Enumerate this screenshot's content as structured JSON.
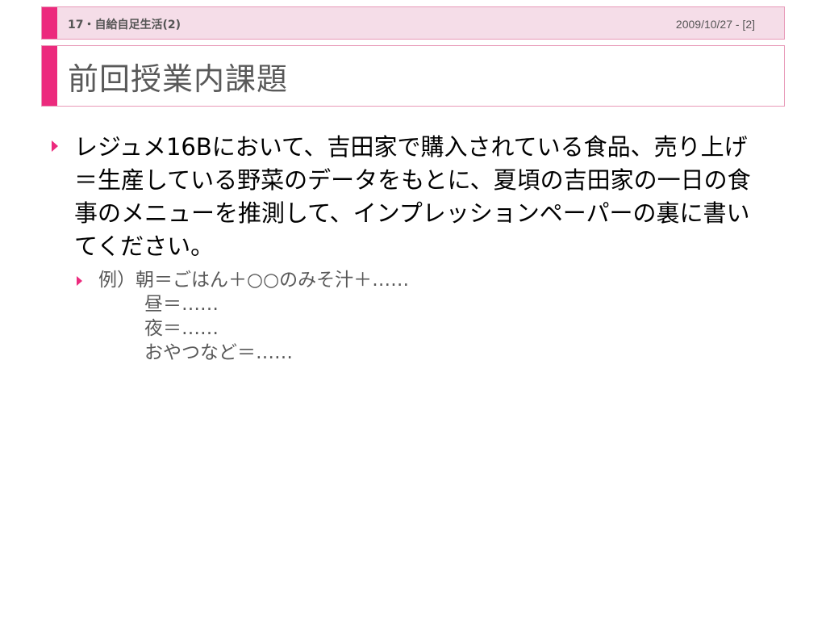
{
  "header": {
    "section": "17・自給自足生活(2)",
    "date_page": "2009/10/27 - [2]"
  },
  "title": "前回授業内課題",
  "body": {
    "bullet1": "レジュメ16Bにおいて、吉田家で購入されている食品、売り上げ＝生産している野菜のデータをもとに、夏頃の吉田家の一日の食事のメニューを推測して、インプレッションペーパーの裏に書いてください。",
    "sub": {
      "line1": "例）朝＝ごはん＋○○のみそ汁＋……",
      "line2": "昼＝……",
      "line3": "夜＝……",
      "line4": "おやつなど＝……"
    }
  },
  "colors": {
    "accent": "#ec2a7d",
    "header_bg": "#f5dde8",
    "border": "#e89ab8"
  }
}
